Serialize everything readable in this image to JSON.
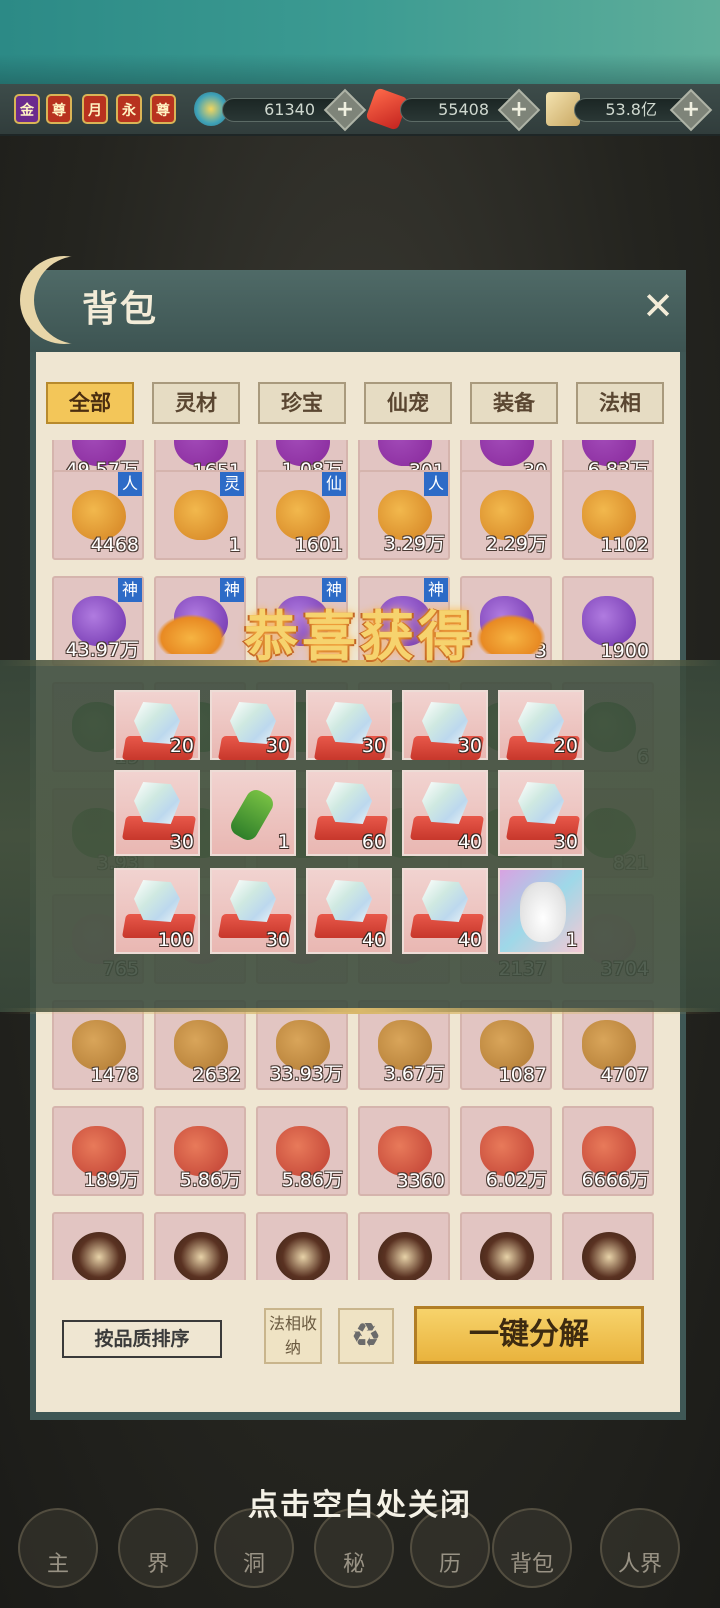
{
  "top_bar": {
    "badges": [
      "金",
      "尊",
      "月",
      "永",
      "尊"
    ],
    "currencies": [
      {
        "icon": "swirl-icon",
        "value": "61340"
      },
      {
        "icon": "red-crystal-icon",
        "value": "55408"
      },
      {
        "icon": "scroll-icon",
        "value": "53.8亿"
      }
    ],
    "plus_label": "+"
  },
  "panel": {
    "title": "背包",
    "close_label": "✕",
    "tabs": [
      {
        "label": "全部",
        "active": true
      },
      {
        "label": "灵材",
        "active": false
      },
      {
        "label": "珍宝",
        "active": false
      },
      {
        "label": "仙宠",
        "active": false
      },
      {
        "label": "装备",
        "active": false
      },
      {
        "label": "法相",
        "active": false
      }
    ],
    "grid_rows": [
      [
        {
          "qty": "49.57万"
        },
        {
          "qty": "1651"
        },
        {
          "qty": "1.08万"
        },
        {
          "qty": "301"
        },
        {
          "qty": "30"
        },
        {
          "qty": "6.83万"
        }
      ],
      [
        {
          "qty": "4468",
          "tag": "人"
        },
        {
          "qty": "1",
          "tag": "灵"
        },
        {
          "qty": "1601",
          "tag": "仙"
        },
        {
          "qty": "3.29万",
          "tag": "人"
        },
        {
          "qty": "2.29万",
          "tag": ""
        },
        {
          "qty": "1102",
          "tag": ""
        }
      ],
      [
        {
          "qty": "43.97万",
          "tag": "神"
        },
        {
          "qty": "",
          "tag": "神"
        },
        {
          "qty": "",
          "tag": "神"
        },
        {
          "qty": "",
          "tag": "神"
        },
        {
          "qty": "3",
          "tag": ""
        },
        {
          "qty": "1900",
          "tag": ""
        }
      ],
      [
        {
          "qty": "19"
        },
        {
          "qty": ""
        },
        {
          "qty": ""
        },
        {
          "qty": ""
        },
        {
          "qty": ""
        },
        {
          "qty": "6"
        }
      ],
      [
        {
          "qty": "3.93"
        },
        {
          "qty": ""
        },
        {
          "qty": ""
        },
        {
          "qty": ""
        },
        {
          "qty": ""
        },
        {
          "qty": "821"
        }
      ],
      [
        {
          "qty": "765"
        },
        {
          "qty": ""
        },
        {
          "qty": ""
        },
        {
          "qty": ""
        },
        {
          "qty": "2137"
        },
        {
          "qty": "3704"
        }
      ],
      [
        {
          "qty": "1478"
        },
        {
          "qty": "2632"
        },
        {
          "qty": "33.93万"
        },
        {
          "qty": "3.67万"
        },
        {
          "qty": "1087"
        },
        {
          "qty": "4707"
        }
      ],
      [
        {
          "qty": "189万"
        },
        {
          "qty": "5.86万"
        },
        {
          "qty": "5.86万"
        },
        {
          "qty": "3360"
        },
        {
          "qty": "6.02万"
        },
        {
          "qty": "6666万"
        }
      ],
      [
        {
          "qty": ""
        },
        {
          "qty": ""
        },
        {
          "qty": ""
        },
        {
          "qty": ""
        },
        {
          "qty": ""
        },
        {
          "qty": ""
        }
      ]
    ],
    "sort_label": "按品质排序",
    "collect_label": "法相收纳",
    "recycle_icon": "♻",
    "decompose_label": "一键分解"
  },
  "reward": {
    "title": "恭喜获得",
    "items": [
      {
        "icon": "gem-cushion-icon",
        "qty": "20"
      },
      {
        "icon": "gem-cushion-icon",
        "qty": "30"
      },
      {
        "icon": "gem-cushion-icon",
        "qty": "30"
      },
      {
        "icon": "gem-cushion-icon",
        "qty": "30"
      },
      {
        "icon": "gem-cushion-icon",
        "qty": "20"
      },
      {
        "icon": "gem-cushion-icon",
        "qty": "30"
      },
      {
        "icon": "green-gourd-icon",
        "qty": "1"
      },
      {
        "icon": "gem-cushion-icon",
        "qty": "60"
      },
      {
        "icon": "gem-cushion-icon",
        "qty": "40"
      },
      {
        "icon": "gem-cushion-icon",
        "qty": "30"
      },
      {
        "icon": "gem-cushion-icon",
        "qty": "100"
      },
      {
        "icon": "gem-cushion-icon",
        "qty": "30"
      },
      {
        "icon": "gem-cushion-icon",
        "qty": "40"
      },
      {
        "icon": "gem-cushion-icon",
        "qty": "40"
      },
      {
        "icon": "cat-vase-icon",
        "qty": "1"
      }
    ],
    "close_hint": "点击空白处关闭"
  },
  "bottom_nav": [
    "主",
    "界",
    "洞",
    "秘",
    "历",
    "背包",
    "人界"
  ]
}
